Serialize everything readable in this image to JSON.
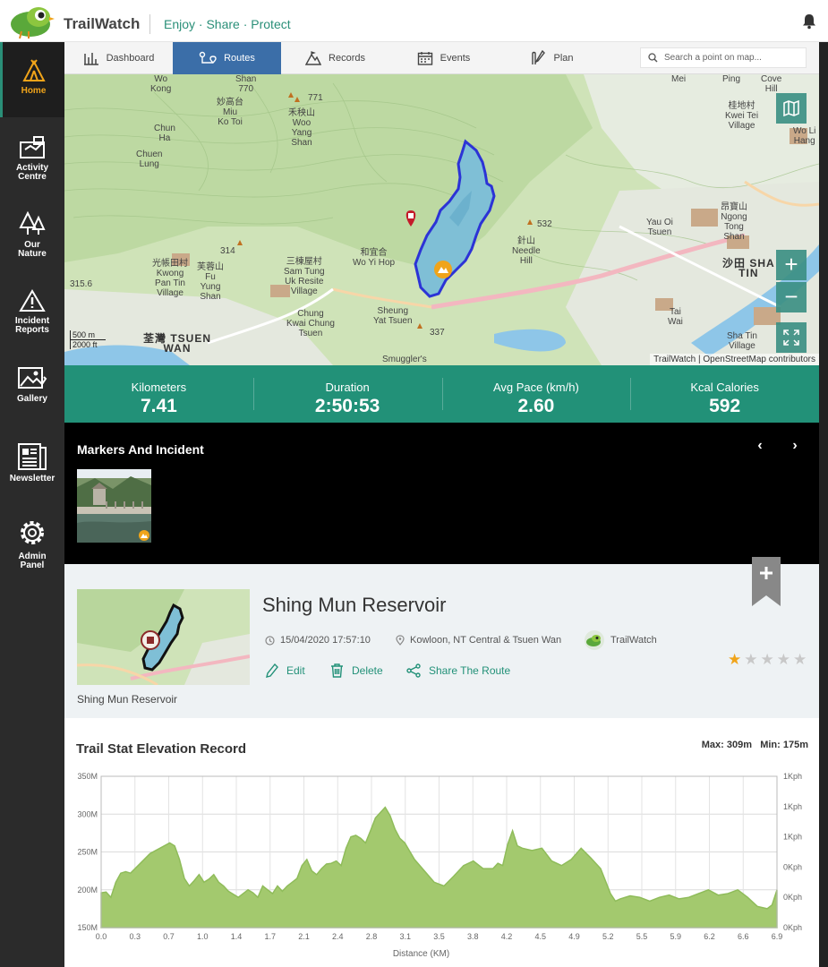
{
  "header": {
    "brand": "TrailWatch",
    "tagline": "Enjoy · Share · Protect",
    "notification_icon": "bell-icon"
  },
  "sidebar": {
    "items": [
      {
        "label": "Home",
        "icon": "tent-icon",
        "active": true
      },
      {
        "label": "Activity Centre",
        "icon": "activity-icon",
        "active": false
      },
      {
        "label": "Our Nature",
        "icon": "trees-icon",
        "active": false
      },
      {
        "label": "Incident Reports",
        "icon": "warning-icon",
        "active": false
      },
      {
        "label": "Gallery",
        "icon": "gallery-icon",
        "active": false
      },
      {
        "label": "Newsletter",
        "icon": "newsletter-icon",
        "active": false
      },
      {
        "label": "Admin Panel",
        "icon": "gear-icon",
        "active": false
      }
    ],
    "active_color": "#f0a41a"
  },
  "tabs": [
    {
      "label": "Dashboard",
      "icon": "dashboard-icon",
      "active": false
    },
    {
      "label": "Routes",
      "icon": "route-icon",
      "active": true
    },
    {
      "label": "Records",
      "icon": "records-icon",
      "active": false
    },
    {
      "label": "Events",
      "icon": "calendar-icon",
      "active": false
    },
    {
      "label": "Plan",
      "icon": "plan-icon",
      "active": false
    }
  ],
  "search": {
    "placeholder": "Search a point on map..."
  },
  "map": {
    "labels": [
      {
        "text": "Wo\nKong",
        "key": "woKong"
      },
      {
        "text": "Shan\n770",
        "key": "shan770"
      },
      {
        "text": "771",
        "key": "p771"
      },
      {
        "text": "妙高台\nMiu\nKo Toi",
        "key": "miuKoToi"
      },
      {
        "text": "禾秧山\nWoo\nYang\nShan",
        "key": "wooYang"
      },
      {
        "text": "Chun\nHa",
        "key": "chunHa"
      },
      {
        "text": "Chuen\nLung",
        "key": "chuenLung"
      },
      {
        "text": "314",
        "key": "p314"
      },
      {
        "text": "光帳田村\nKwong\nPan Tin\nVillage",
        "key": "kwongPan"
      },
      {
        "text": "芙蓉山\nFu\nYung\nShan",
        "key": "fuYung"
      },
      {
        "text": "三棟屋村\nSam Tung\nUk Resite\nVillage",
        "key": "samTung"
      },
      {
        "text": "和宜合\nWo Yi Hop",
        "key": "woYiHop"
      },
      {
        "text": "532",
        "key": "p532"
      },
      {
        "text": "針山\nNeedle\nHill",
        "key": "needleHill"
      },
      {
        "text": "Mei",
        "key": "mei"
      },
      {
        "text": "Ping",
        "key": "ping"
      },
      {
        "text": "Cove\nHill",
        "key": "coveHill"
      },
      {
        "text": "桂地村\nKwei Tei\nVillage",
        "key": "kweiTei"
      },
      {
        "text": "Wo Li\nHang",
        "key": "woLi"
      },
      {
        "text": "Yau Oi\nTsuen",
        "key": "yauOi"
      },
      {
        "text": "昂寶山\nNgong\nTong\nShan",
        "key": "ngongTong"
      },
      {
        "text": "沙田 SHA\nTIN",
        "key": "shaTin"
      },
      {
        "text": "Sheung\nYat Tsuen",
        "key": "sheungYat"
      },
      {
        "text": "337",
        "key": "p337"
      },
      {
        "text": "Chung\nKwai Chung\nTsuen",
        "key": "kwaiChung"
      },
      {
        "text": "荃灣 TSUEN\nWAN",
        "key": "tsuenWan"
      },
      {
        "text": "315.6",
        "key": "p315"
      },
      {
        "text": "Smuggler's",
        "key": "smugglers"
      },
      {
        "text": "Tai\nWai",
        "key": "taiWai"
      },
      {
        "text": "Sha Tin\nVillage",
        "key": "shaTinV"
      }
    ],
    "scale": {
      "metric": "500 m",
      "imperial": "2000 ft"
    },
    "attribution": "TrailWatch | OpenStreetMap contributors",
    "controls": [
      "layers-icon",
      "zoom-in-icon",
      "zoom-out-icon",
      "fullscreen-icon"
    ],
    "zoom_in": "+",
    "zoom_out": "−"
  },
  "stats": [
    {
      "label": "Kilometers",
      "value": "7.41"
    },
    {
      "label": "Duration",
      "value": "2:50:53"
    },
    {
      "label": "Avg Pace (km/h)",
      "value": "2.60"
    },
    {
      "label": "Kcal Calories",
      "value": "592"
    }
  ],
  "markers": {
    "title": "Markers And Incident",
    "prev": "‹",
    "next": "›"
  },
  "route": {
    "title": "Shing Mun Reservoir",
    "caption": "Shing Mun Reservoir",
    "datetime": "15/04/2020 17:57:10",
    "location": "Kowloon, NT Central & Tsuen Wan",
    "author": "TrailWatch",
    "actions": {
      "edit": "Edit",
      "delete": "Delete",
      "share": "Share The Route"
    },
    "rating": 1,
    "rating_max": 5,
    "rating_color": "#f0a41a"
  },
  "elevation": {
    "title": "Trail Stat Elevation Record",
    "max_label": "Max: 309m",
    "min_label": "Min: 175m"
  },
  "chart_data": {
    "type": "area",
    "title": "Trail Stat Elevation Record",
    "xlabel": "Distance (KM)",
    "ylabel": "",
    "xlim": [
      0.0,
      6.9
    ],
    "ylim": [
      150,
      350
    ],
    "x_ticks": [
      "0.0",
      "0.3",
      "0.7",
      "1.0",
      "1.4",
      "1.7",
      "2.1",
      "2.4",
      "2.8",
      "3.1",
      "3.5",
      "3.8",
      "4.2",
      "4.5",
      "4.9",
      "5.2",
      "5.5",
      "5.9",
      "6.2",
      "6.6",
      "6.9"
    ],
    "y_ticks": [
      "150M",
      "200M",
      "250M",
      "300M",
      "350M"
    ],
    "y2_ticks": [
      "0Kph",
      "0Kph",
      "0Kph",
      "1Kph",
      "1Kph",
      "1Kph"
    ],
    "grid": true,
    "fill_color": "#a3c96e",
    "line_color": "#8fbc5a",
    "x": [
      0.0,
      0.05,
      0.1,
      0.15,
      0.2,
      0.25,
      0.3,
      0.4,
      0.5,
      0.6,
      0.7,
      0.75,
      0.8,
      0.85,
      0.9,
      0.95,
      1.0,
      1.05,
      1.1,
      1.15,
      1.2,
      1.25,
      1.3,
      1.4,
      1.5,
      1.55,
      1.6,
      1.65,
      1.7,
      1.75,
      1.8,
      1.85,
      1.9,
      1.95,
      2.0,
      2.05,
      2.1,
      2.15,
      2.2,
      2.25,
      2.3,
      2.35,
      2.4,
      2.45,
      2.5,
      2.55,
      2.6,
      2.65,
      2.7,
      2.75,
      2.8,
      2.85,
      2.9,
      2.95,
      3.0,
      3.05,
      3.1,
      3.2,
      3.3,
      3.4,
      3.5,
      3.6,
      3.7,
      3.8,
      3.9,
      4.0,
      4.05,
      4.1,
      4.15,
      4.2,
      4.25,
      4.3,
      4.4,
      4.5,
      4.6,
      4.7,
      4.8,
      4.9,
      5.0,
      5.1,
      5.2,
      5.25,
      5.3,
      5.4,
      5.5,
      5.6,
      5.7,
      5.8,
      5.9,
      6.0,
      6.1,
      6.2,
      6.3,
      6.4,
      6.5,
      6.6,
      6.7,
      6.8,
      6.85,
      6.9
    ],
    "values": [
      196,
      197,
      190,
      210,
      222,
      224,
      222,
      235,
      248,
      255,
      262,
      258,
      240,
      215,
      205,
      212,
      220,
      210,
      214,
      220,
      210,
      205,
      198,
      190,
      200,
      196,
      190,
      205,
      200,
      195,
      205,
      198,
      205,
      210,
      215,
      232,
      240,
      225,
      220,
      228,
      234,
      235,
      238,
      232,
      255,
      270,
      272,
      268,
      262,
      278,
      295,
      302,
      309,
      298,
      280,
      268,
      262,
      240,
      225,
      210,
      205,
      218,
      232,
      238,
      228,
      228,
      235,
      232,
      260,
      278,
      258,
      255,
      252,
      255,
      238,
      232,
      240,
      255,
      242,
      228,
      195,
      185,
      188,
      192,
      190,
      185,
      190,
      193,
      188,
      190,
      195,
      200,
      193,
      195,
      200,
      190,
      178,
      175,
      180,
      200
    ]
  }
}
